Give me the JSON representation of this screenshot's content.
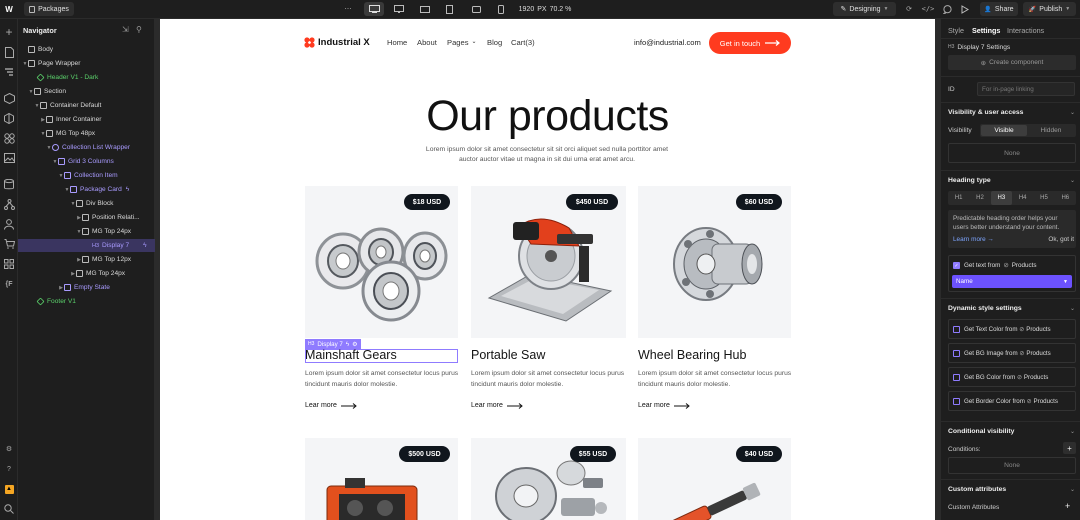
{
  "topbar": {
    "page_name": "Packages",
    "width_value": "1920",
    "width_unit": "PX",
    "zoom": "70.2 %",
    "mode_label": "Designing",
    "share_label": "Share",
    "publish_label": "Publish"
  },
  "navigator": {
    "title": "Navigator",
    "items": [
      {
        "label": "Body"
      },
      {
        "label": "Page Wrapper"
      },
      {
        "label": "Header V1 - Dark"
      },
      {
        "label": "Section"
      },
      {
        "label": "Container Default"
      },
      {
        "label": "Inner Container"
      },
      {
        "label": "MG Top 48px"
      },
      {
        "label": "Collection List Wrapper"
      },
      {
        "label": "Grid 3 Columns"
      },
      {
        "label": "Collection Item"
      },
      {
        "label": "Package Card"
      },
      {
        "label": "Div Block"
      },
      {
        "label": "Position Relati..."
      },
      {
        "label": "MG Top 24px"
      },
      {
        "label": "Display 7",
        "tag": "H3"
      },
      {
        "label": "MG Top 12px"
      },
      {
        "label": "MG Top 24px"
      },
      {
        "label": "Empty State"
      },
      {
        "label": "Footer V1"
      }
    ]
  },
  "site": {
    "brand": "Industrial X",
    "nav": [
      "Home",
      "About",
      "Pages",
      "Blog",
      "Cart(3)"
    ],
    "email": "info@industrial.com",
    "cta": "Get in touch",
    "heading": "Our products",
    "intro": "Lorem ipsum dolor sit amet consectetur sit sit orci aliquet sed nulla porttitor amet auctor auctor vitae ut magna in sit dui urna erat amet arcu.",
    "selection_tag": "H3",
    "selection_label": "Display 7",
    "products": [
      {
        "title": "Mainshaft Gears",
        "price": "$18 USD",
        "desc": "Lorem ipsum dolor sit amet consectetur locus purus tincidunt mauris dolor molestie.",
        "more": "Lear more"
      },
      {
        "title": "Portable Saw",
        "price": "$450 USD",
        "desc": "Lorem ipsum dolor sit amet consectetur locus purus tincidunt mauris dolor molestie.",
        "more": "Lear more"
      },
      {
        "title": "Wheel Bearing Hub",
        "price": "$60 USD",
        "desc": "Lorem ipsum dolor sit amet consectetur locus purus tincidunt mauris dolor molestie.",
        "more": "Lear more"
      },
      {
        "title": "",
        "price": "$500 USD",
        "desc": "",
        "more": ""
      },
      {
        "title": "",
        "price": "$55 USD",
        "desc": "",
        "more": ""
      },
      {
        "title": "",
        "price": "$40 USD",
        "desc": "",
        "more": ""
      }
    ]
  },
  "panel": {
    "tabs": [
      "Style",
      "Settings",
      "Interactions"
    ],
    "element_tag": "H3",
    "element_settings": "Display 7 Settings",
    "create_component": "Create component",
    "id_label": "ID",
    "id_placeholder": "For in-page linking",
    "visibility_title": "Visibility & user access",
    "visibility_label": "Visibility",
    "visible_label": "Visible",
    "hidden_label": "Hidden",
    "none_label": "None",
    "heading_type_title": "Heading type",
    "heading_levels": [
      "H1",
      "H2",
      "H3",
      "H4",
      "H5",
      "H6"
    ],
    "heading_tip": "Predictable heading order helps your users better understand your content.",
    "learn_more": "Learn more →",
    "ok_label": "Ok, got it",
    "get_text_from": "Get text from",
    "products_label": "Products",
    "name_value": "Name",
    "dynamic_title": "Dynamic style settings",
    "dynamic_items": [
      {
        "label": "Get Text Color from",
        "source": "Products"
      },
      {
        "label": "Get BG Image from",
        "source": "Products"
      },
      {
        "label": "Get BG Color from",
        "source": "Products"
      },
      {
        "label": "Get Border Color from",
        "source": "Products"
      }
    ],
    "conditional_title": "Conditional visibility",
    "conditions_label": "Conditions:",
    "none2_label": "None",
    "custom_attr_title": "Custom attributes",
    "custom_attr_label": "Custom Attributes"
  },
  "colors": {
    "accent": "#ff3b1f",
    "selection": "#8f7bff",
    "dark_badge": "#10161d"
  }
}
